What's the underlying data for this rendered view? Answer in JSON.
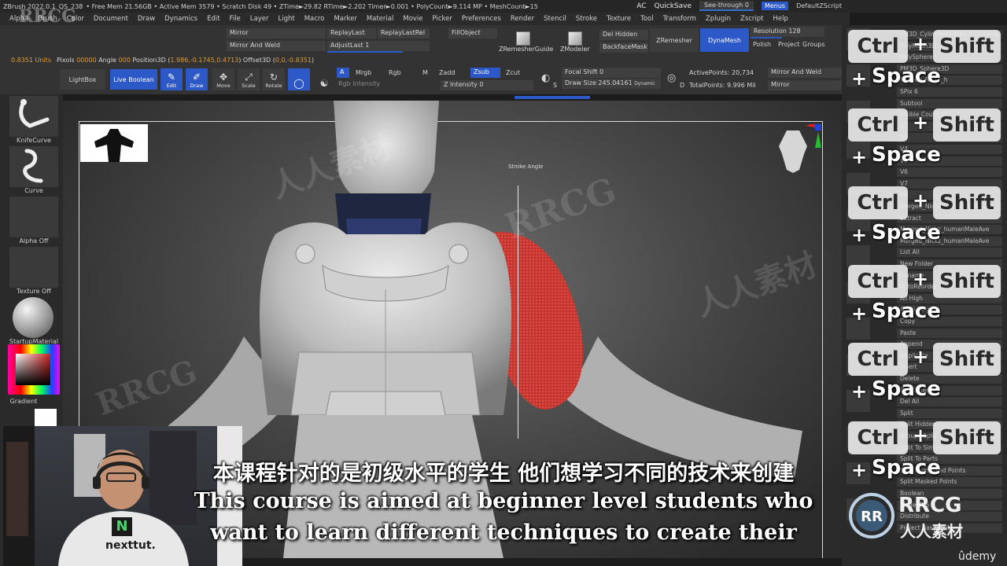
{
  "titlebar": {
    "app": "ZBrush 2022.0.1",
    "qs": "QS_238",
    "stats": "• Free Mem 21.56GB • Active Mem 3579 • Scratch Disk 49 • ZTime►29.82 RTime►2.202 Timer►0.001 • PolyCount►9.114 MP • MeshCount►15",
    "ac": "AC",
    "quicksave": "QuickSave",
    "seethrough": "See-through",
    "seethrough_value": "0",
    "menus": "Menus",
    "default": "DefaultZScript"
  },
  "menubar": [
    "Alpha",
    "Brush",
    "Color",
    "Document",
    "Draw",
    "Dynamics",
    "Edit",
    "File",
    "Layer",
    "Light",
    "Macro",
    "Marker",
    "Material",
    "Movie",
    "Picker",
    "Preferences",
    "Render",
    "Stencil",
    "Stroke",
    "Texture",
    "Tool",
    "Transform",
    "Zplugin",
    "Zscript",
    "Help"
  ],
  "shelf": {
    "units": "0.8351 Units",
    "pixols": "Pixols",
    "pixols_value": "00000",
    "angle": "Angle",
    "angle_value": "000",
    "position3d": "Position3D (",
    "position3d_value": "1.986,-0.1745,0.4713",
    "offset3d": ") Offset3D (",
    "offset3d_value": "0,0,-0.8351",
    "close_paren": ")",
    "mirror": "Mirror",
    "mirror_weld": "Mirror And Weld",
    "replay_last": "ReplayLast",
    "replay_last_rel": "ReplayLastRel",
    "adjust_last": "AdjustLast 1",
    "fill_object": "FillObject",
    "zremesher_guide": "ZRemesherGuide",
    "zmodeler": "ZModeler",
    "del_hidden": "Del Hidden",
    "backface_mask": "BackfaceMask",
    "zremesher": "ZRemesher",
    "dynamesh": "DynaMesh",
    "resolution": "Resolution 128",
    "polish": "Polish",
    "project": "Project",
    "groups": "Groups",
    "lightbox": "LightBox",
    "live_boolean": "Live Boolean",
    "edit": "Edit",
    "draw": "Draw",
    "move": "Move",
    "scale": "Scale",
    "rotate": "Rotate",
    "a": "A",
    "mrgb": "Mrgb",
    "rgb": "Rgb",
    "m": "M",
    "zadd": "Zadd",
    "zsub": "Zsub",
    "zcut": "Zcut",
    "rgb_intensity": "Rgb Intensity",
    "z_intensity": "Z Intensity 0",
    "focal_shift": "Focal Shift 0",
    "draw_size": "Draw Size 245.04161",
    "dynamic": "Dynamic",
    "active_points": "ActivePoints: 20,734",
    "total_points": "TotalPoints: 9.996 Mil",
    "mirror_weld2": "Mirror And Weld",
    "mirror2": "Mirror",
    "s_label": "S",
    "d_label": "D"
  },
  "lefttray": {
    "knife_curve": "KnifeCurve",
    "curve": "Curve",
    "alpha_off": "Alpha Off",
    "texture_off": "Texture Off",
    "startup_material": "StartupMaterial",
    "gradient": "Gradient"
  },
  "viewport": {
    "cursor_label": "Stroke Angle"
  },
  "rightpanel": {
    "rows": [
      "PM3D_Cylinder8 PM3D_Cylinder8",
      "PolyMesh3D",
      "PolySphere",
      "PM3D_Sphere3D",
      "Merged_Nickz_h",
      "SPix 6",
      "Subtool",
      "Visible Count 15",
      "V2",
      "V3",
      "V4",
      "V5",
      "V6",
      "V7",
      "V8",
      "Merged_Nickz_humanMaleAve",
      "Extract",
      "Merged_Nickz_humanMaleAve",
      "Merged_Nickz_humanMaleAve",
      "List All",
      "New Folder",
      "Rename",
      "AutoReorder",
      "All High",
      "All To Target",
      "Copy",
      "Paste",
      "Append",
      "Duplicate",
      "Insert",
      "Delete",
      "Del Other",
      "Del All",
      "Split",
      "Split Hidden",
      "Groups Split",
      "Split To Similar Parts",
      "Split To Parts",
      "Split Unmasked Points",
      "Split Masked Points",
      "Boolean",
      "Model Pro",
      "Distribute",
      "Project BasRelief"
    ]
  },
  "keys": {
    "ctrl": "Ctrl",
    "plus": "+",
    "shift": "Shift",
    "space": "Space"
  },
  "subtitles": {
    "cn": "本课程针对的是初级水平的学生 他们想学习不同的技术来创建",
    "en1": "This course is aimed at beginner level students who",
    "en2": "want to learn different techniques to create their"
  },
  "webcam": {
    "shirt_logo": "N",
    "shirt_text": "nexttut."
  },
  "branding": {
    "rrcg": "RRCG",
    "rrcg_cn": "人人素材",
    "udemy": "ûdemy",
    "watermark_en": "RRCG",
    "watermark_cn": "人人素材"
  },
  "colors": {
    "accent_blue": "#2d58c8",
    "units_orange": "#e09a2e",
    "mask_red": "#c8342e",
    "collar_blue": "#2e3a6e"
  }
}
